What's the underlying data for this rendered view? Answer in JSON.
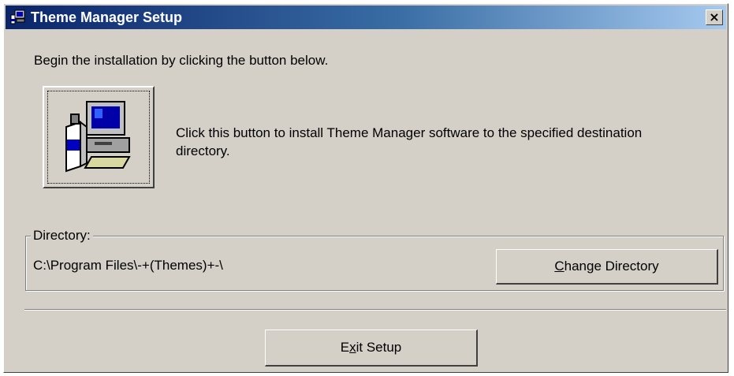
{
  "window": {
    "title": "Theme Manager Setup",
    "close_label": "×"
  },
  "intro_text": "Begin the installation by clicking the button below.",
  "install": {
    "description": "Click this button to install Theme Manager software to the specified destination directory."
  },
  "directory": {
    "group_label": "Directory:",
    "path": "C:\\Program Files\\-+(Themes)+-\\",
    "change_button": {
      "label_pre": "",
      "label_key": "C",
      "label_post": "hange Directory"
    }
  },
  "exit_button": {
    "label_pre": "E",
    "label_key": "x",
    "label_post": "it Setup"
  },
  "colors": {
    "title_gradient_start": "#0a246a",
    "title_gradient_end": "#a6caf0",
    "dialog_face": "#d4d0c8"
  },
  "icons": {
    "title": "setup-computer-icon",
    "install": "computer-install-icon"
  }
}
